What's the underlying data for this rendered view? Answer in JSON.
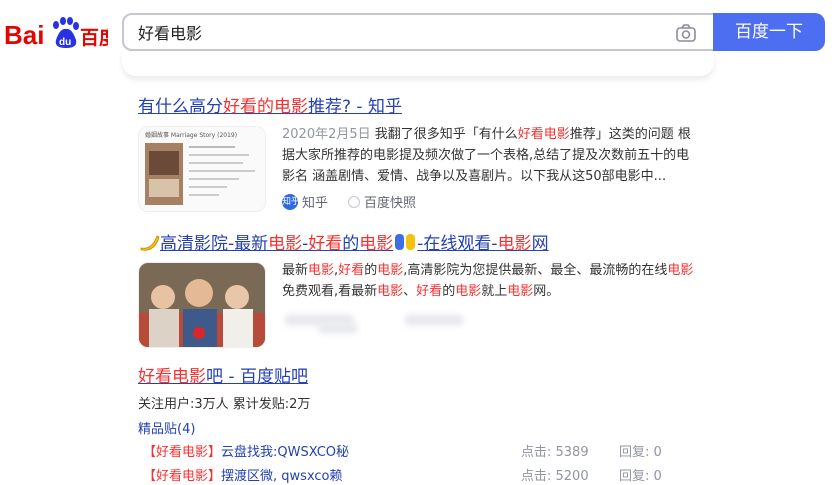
{
  "search": {
    "query": "好看电影",
    "button_label": "百度一下"
  },
  "results": [
    {
      "title_parts": [
        "有什么高分",
        "好看的",
        "电影",
        "推荐? - 知乎"
      ],
      "snippet_date": "2020年2月5日",
      "snippet_parts": [
        " 我翻了很多知乎「有什么",
        "好看电影",
        "推荐」这类的问题 根据大家所推荐的电影提及频次做了一个表格,总结了提及次数前五十的电影名 涵盖剧情、爱情、战争以及喜剧片。以下我从这50部电影中..."
      ],
      "source_name": "知乎",
      "source_icon_text": "知乎",
      "snapshot_label": "百度快照",
      "thumb_title": "婚姻故事 Marriage Story (2019)"
    },
    {
      "title_parts": [
        "高清影院-最新",
        "电影",
        "-",
        "好看",
        "的",
        "电影",
        "-在线观看-",
        "电影",
        "网"
      ],
      "snippet_parts": [
        "最新",
        "电影",
        ",",
        "好看",
        "的",
        "电影",
        ",高清影院为您提供最新、最全、最流畅的在线",
        "电影",
        "免费观看,看最新",
        "电影",
        "、",
        "好看",
        "的",
        "电影",
        "就上",
        "电影",
        "网。"
      ]
    },
    {
      "title_parts": [
        "好看电影",
        "吧 - 百度贴吧"
      ],
      "stats": "关注用户:3万人   累计发贴:2万",
      "featured_link": "精品贴(4)",
      "posts": [
        {
          "tag": "【好看电影】",
          "text": "云盘找我:QWSXCO秘",
          "clicks": "点击: 5389",
          "replies": "回复: 0"
        },
        {
          "tag": "【好看电影】",
          "text": "摆渡区微, qwsxco赖",
          "clicks": "点击: 5200",
          "replies": "回复: 0"
        }
      ]
    }
  ],
  "colors": {
    "link": "#2440b3",
    "highlight": "#f73131",
    "button": "#4e6ef2"
  }
}
